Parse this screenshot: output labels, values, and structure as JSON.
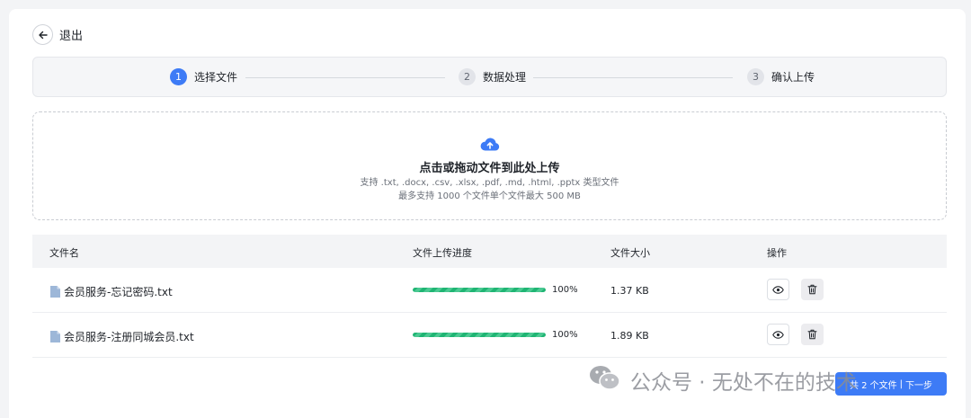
{
  "header": {
    "back_label": "退出"
  },
  "steps": [
    {
      "num": "1",
      "label": "选择文件",
      "active": true
    },
    {
      "num": "2",
      "label": "数据处理",
      "active": false
    },
    {
      "num": "3",
      "label": "确认上传",
      "active": false
    }
  ],
  "upload": {
    "title": "点击或拖动文件到此处上传",
    "hint_types": "支持 .txt, .docx, .csv, .xlsx, .pdf, .md, .html, .pptx 类型文件",
    "hint_limit": "最多支持 1000 个文件单个文件最大 500 MB"
  },
  "table": {
    "headers": [
      "文件名",
      "文件上传进度",
      "文件大小",
      "操作"
    ],
    "rows": [
      {
        "name": "会员服务-忘记密码.txt",
        "progress": 100,
        "progress_label": "100%",
        "size": "1.37 KB"
      },
      {
        "name": "会员服务-注册同城会员.txt",
        "progress": 100,
        "progress_label": "100%",
        "size": "1.89 KB"
      }
    ]
  },
  "footer": {
    "file_count": "共 2 个文件",
    "next_label": "下一步"
  },
  "watermark": {
    "text": "公众号 · 无处不在的技术"
  },
  "colors": {
    "primary": "#3d7bf6",
    "progress": "#1fb573",
    "header_bg": "#f3f4f6"
  }
}
